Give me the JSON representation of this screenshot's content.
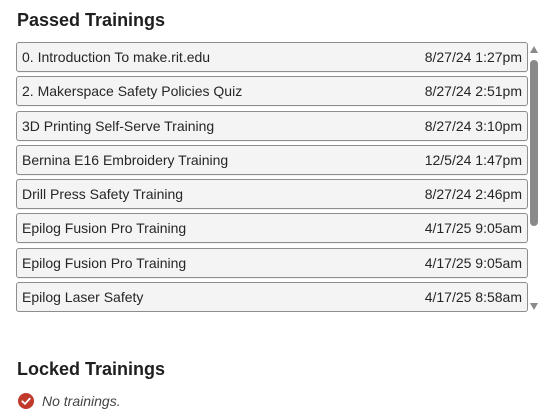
{
  "passed": {
    "title": "Passed Trainings",
    "items": [
      {
        "name": "0. Introduction To make.rit.edu",
        "date": "8/27/24 1:27pm"
      },
      {
        "name": "2. Makerspace Safety Policies Quiz",
        "date": "8/27/24 2:51pm"
      },
      {
        "name": "3D Printing Self-Serve Training",
        "date": "8/27/24 3:10pm"
      },
      {
        "name": "Bernina E16 Embroidery Training",
        "date": "12/5/24 1:47pm"
      },
      {
        "name": "Drill Press Safety Training",
        "date": "8/27/24 2:46pm"
      },
      {
        "name": "Epilog Fusion Pro Training",
        "date": "4/17/25 9:05am"
      },
      {
        "name": "Epilog Fusion Pro Training",
        "date": "4/17/25 9:05am"
      },
      {
        "name": "Epilog Laser Safety",
        "date": "4/17/25 8:58am"
      }
    ]
  },
  "locked": {
    "title": "Locked Trainings",
    "empty_text": "No trainings.",
    "empty_icon": "check-circle-icon"
  },
  "colors": {
    "accent_red": "#c0392b",
    "row_border": "#8d8d8d",
    "row_background": "#f4f4f4",
    "scrollbar": "#8a8a8a"
  }
}
